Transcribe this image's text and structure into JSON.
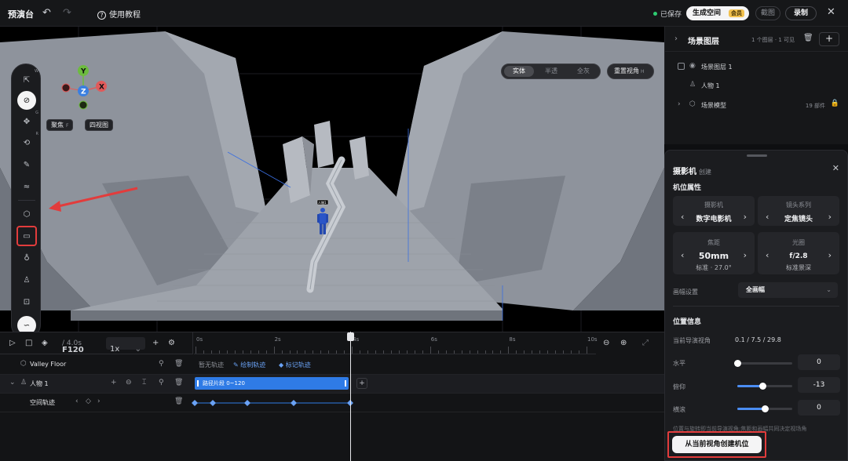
{
  "topbar": {
    "title": "预演台",
    "help": "使用教程",
    "saved": "已保存",
    "generate_button": "生成空间",
    "generate_badge": "会员",
    "screenshot_button": "截图",
    "record_button": "录制"
  },
  "viewport": {
    "focus_label": "聚焦",
    "focus_key": "F",
    "quad_view_label": "四视图",
    "render_modes": [
      "实体",
      "半透",
      "全灰"
    ],
    "active_mode": "实体",
    "reset_view_label": "重置视角",
    "reset_view_key": "H",
    "gizmo_axes": [
      "Y",
      "Z",
      "X"
    ],
    "person_tag": "人物1",
    "tool_keys": [
      "W",
      "G",
      "G",
      "R"
    ],
    "colors": {
      "axis_x": "#e05a5a",
      "axis_y": "#6dbb3f",
      "axis_z": "#3a7fe0",
      "highlight": "#e23c3c"
    }
  },
  "layers": {
    "title": "场景图层",
    "meta": "1 个图层 · 1 可见",
    "items": [
      {
        "label": "场景图层 1"
      },
      {
        "label": "人物 1"
      },
      {
        "label": "场景模型",
        "right": "19 部件"
      }
    ]
  },
  "camera": {
    "title": "摄影机",
    "subtitle": "创建",
    "section_position_props": "机位属性",
    "cards": [
      {
        "label": "摄影机",
        "value": "数字电影机"
      },
      {
        "label": "镜头系列",
        "value": "定焦镜头"
      },
      {
        "label": "焦距",
        "value": "50mm",
        "sub": "标准 · 27.0°"
      },
      {
        "label": "光圈",
        "value": "f/2.8",
        "sub": "标准景深"
      }
    ],
    "format_label": "画幅设置",
    "format_value": "全画幅",
    "section_position_info": "位置信息",
    "current_view_label": "当前导演视角",
    "current_view_value": "0.1 / 7.5 / 29.8",
    "sliders": [
      {
        "label": "水平",
        "value": "0",
        "fraction": 0.0
      },
      {
        "label": "俯仰",
        "value": "-13",
        "fraction": 0.45
      },
      {
        "label": "横滚",
        "value": "0",
        "fraction": 0.5
      }
    ],
    "note": "位置与旋转即当前导演视角;焦距和画幅共同决定视场角",
    "create_button": "从当前视角创建机位"
  },
  "timeline": {
    "frame": "F120",
    "duration": "/ 4.0s",
    "speed": "1x",
    "ruler_labels": [
      "0s",
      "2s",
      "4s",
      "6s",
      "8s",
      "10s"
    ],
    "rows": [
      {
        "name": "Valley Floor",
        "empty": "暂无轨迹",
        "draw": "绘制轨迹",
        "mark": "标记轨迹"
      },
      {
        "name": "人物 1",
        "segment": "路径片段 0~120"
      },
      {
        "name": "空间轨迹"
      }
    ]
  }
}
